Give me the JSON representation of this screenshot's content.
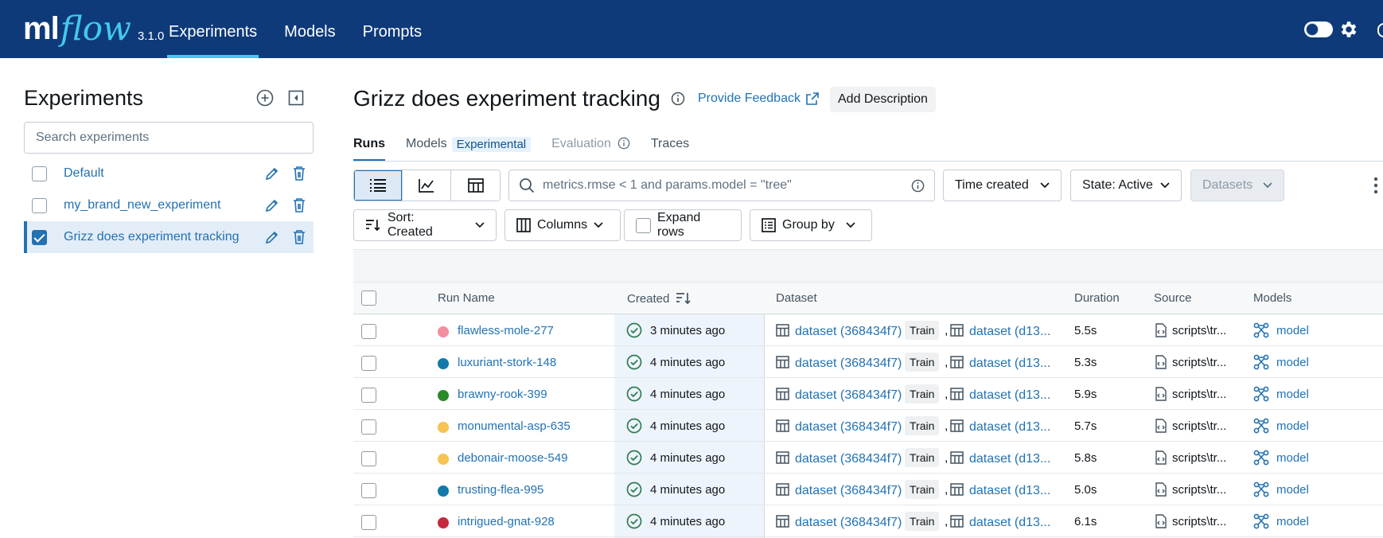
{
  "app": {
    "logo_ml": "ml",
    "logo_flow": "flow",
    "version": "3.1.0",
    "nav": [
      "Experiments",
      "Models",
      "Prompts"
    ]
  },
  "sidebar": {
    "title": "Experiments",
    "search_placeholder": "Search experiments",
    "experiments": [
      {
        "name": "Default",
        "checked": false
      },
      {
        "name": "my_brand_new_experiment",
        "checked": false
      },
      {
        "name": "Grizz does experiment tracking",
        "checked": true
      }
    ]
  },
  "header": {
    "title": "Grizz does experiment tracking",
    "feedback": "Provide Feedback",
    "add_description": "Add Description"
  },
  "tabs": {
    "runs": "Runs",
    "models": "Models",
    "models_tag": "Experimental",
    "evaluation": "Evaluation",
    "traces": "Traces"
  },
  "toolbar": {
    "search_placeholder": "metrics.rmse < 1 and params.model = \"tree\"",
    "time_created": "Time created",
    "state": "State: Active",
    "datasets": "Datasets",
    "sort": "Sort: Created",
    "columns": "Columns",
    "expand_rows": "Expand rows",
    "group_by": "Group by"
  },
  "table": {
    "columns": {
      "run_name": "Run Name",
      "created": "Created",
      "dataset": "Dataset",
      "duration": "Duration",
      "source": "Source",
      "models": "Models"
    },
    "rows": [
      {
        "name": "flawless-mole-277",
        "color": "#f28ea0",
        "created": "3 minutes ago",
        "ds1": "dataset (368434f7)",
        "tag": "Train",
        "ds2": "dataset (d13...",
        "duration": "5.5s",
        "source": "scripts\\tr...",
        "model": "model"
      },
      {
        "name": "luxuriant-stork-148",
        "color": "#1279a8",
        "created": "4 minutes ago",
        "ds1": "dataset (368434f7)",
        "tag": "Train",
        "ds2": "dataset (d13...",
        "duration": "5.3s",
        "source": "scripts\\tr...",
        "model": "model"
      },
      {
        "name": "brawny-rook-399",
        "color": "#2a8a2a",
        "created": "4 minutes ago",
        "ds1": "dataset (368434f7)",
        "tag": "Train",
        "ds2": "dataset (d13...",
        "duration": "5.9s",
        "source": "scripts\\tr...",
        "model": "model"
      },
      {
        "name": "monumental-asp-635",
        "color": "#f5c451",
        "created": "4 minutes ago",
        "ds1": "dataset (368434f7)",
        "tag": "Train",
        "ds2": "dataset (d13...",
        "duration": "5.7s",
        "source": "scripts\\tr...",
        "model": "model"
      },
      {
        "name": "debonair-moose-549",
        "color": "#f5c451",
        "created": "4 minutes ago",
        "ds1": "dataset (368434f7)",
        "tag": "Train",
        "ds2": "dataset (d13...",
        "duration": "5.8s",
        "source": "scripts\\tr...",
        "model": "model"
      },
      {
        "name": "trusting-flea-995",
        "color": "#1279a8",
        "created": "4 minutes ago",
        "ds1": "dataset (368434f7)",
        "tag": "Train",
        "ds2": "dataset (d13...",
        "duration": "5.0s",
        "source": "scripts\\tr...",
        "model": "model"
      },
      {
        "name": "intrigued-gnat-928",
        "color": "#c6283e",
        "created": "4 minutes ago",
        "ds1": "dataset (368434f7)",
        "tag": "Train",
        "ds2": "dataset (d13...",
        "duration": "6.1s",
        "source": "scripts\\tr...",
        "model": "model"
      }
    ]
  },
  "colors": {
    "topbar": "#0e3a7a",
    "accent": "#43c9ed",
    "link": "#2272b4",
    "success": "#2f7d4f"
  }
}
